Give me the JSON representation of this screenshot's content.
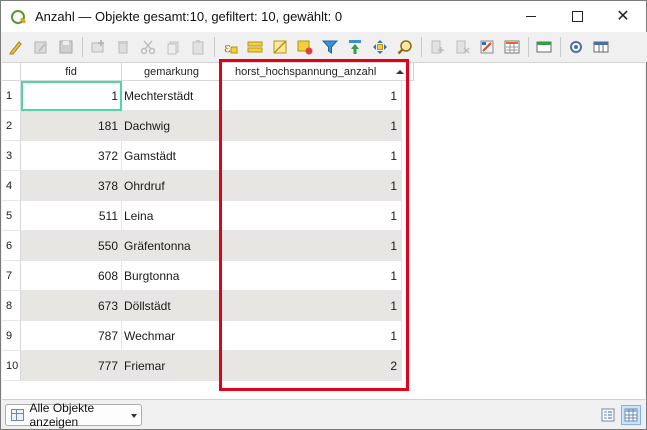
{
  "window": {
    "title": "Anzahl — Objekte gesamt:10, gefiltert: 10, gewählt: 0",
    "controls": {
      "minimize_icon": "minimize-icon",
      "maximize_icon": "maximize-icon",
      "close_glyph": "✕"
    }
  },
  "toolbar": {
    "buttons": [
      "toggle-editing-icon",
      "toggle-multi-edit-icon",
      "save-edits-icon",
      "add-feature-icon",
      "delete-selected-icon",
      "cut-icon",
      "copy-icon",
      "paste-icon",
      "select-by-expression-icon",
      "select-all-icon",
      "invert-selection-icon",
      "deselect-all-icon",
      "filter-select-icon",
      "move-selection-top-icon",
      "pan-to-selected-icon",
      "zoom-to-selected-icon",
      "new-field-icon",
      "delete-field-icon",
      "field-calculator-icon",
      "conditional-formatting-icon",
      "dock-table-icon",
      "actions-icon",
      "organize-columns-icon"
    ]
  },
  "table": {
    "columns": [
      {
        "key": "fid",
        "label": "fid"
      },
      {
        "key": "gemarkung",
        "label": "gemarkung"
      },
      {
        "key": "horst",
        "label": "horst_hochspannung_anzahl",
        "sorted": "ascending"
      }
    ],
    "rows": [
      {
        "n": "1",
        "fid": "1",
        "gemarkung": "Mechterstädt",
        "horst": "1"
      },
      {
        "n": "2",
        "fid": "181",
        "gemarkung": "Dachwig",
        "horst": "1"
      },
      {
        "n": "3",
        "fid": "372",
        "gemarkung": "Gamstädt",
        "horst": "1"
      },
      {
        "n": "4",
        "fid": "378",
        "gemarkung": "Ohrdruf",
        "horst": "1"
      },
      {
        "n": "5",
        "fid": "511",
        "gemarkung": "Leina",
        "horst": "1"
      },
      {
        "n": "6",
        "fid": "550",
        "gemarkung": "Gräfentonna",
        "horst": "1"
      },
      {
        "n": "7",
        "fid": "608",
        "gemarkung": "Burgtonna",
        "horst": "1"
      },
      {
        "n": "8",
        "fid": "673",
        "gemarkung": "Döllstädt",
        "horst": "1"
      },
      {
        "n": "9",
        "fid": "787",
        "gemarkung": "Wechmar",
        "horst": "1"
      },
      {
        "n": "10",
        "fid": "777",
        "gemarkung": "Friemar",
        "horst": "2"
      }
    ],
    "current_cell": {
      "row": 0,
      "column": "fid"
    },
    "highlight_color": "#e3001b",
    "current_cell_color": "#4ed6a6"
  },
  "statusbar": {
    "filter_label": "Alle Objekte anzeigen",
    "filter_icon": "table-filter-icon",
    "view_buttons": [
      "form-view-icon",
      "table-view-icon"
    ]
  }
}
